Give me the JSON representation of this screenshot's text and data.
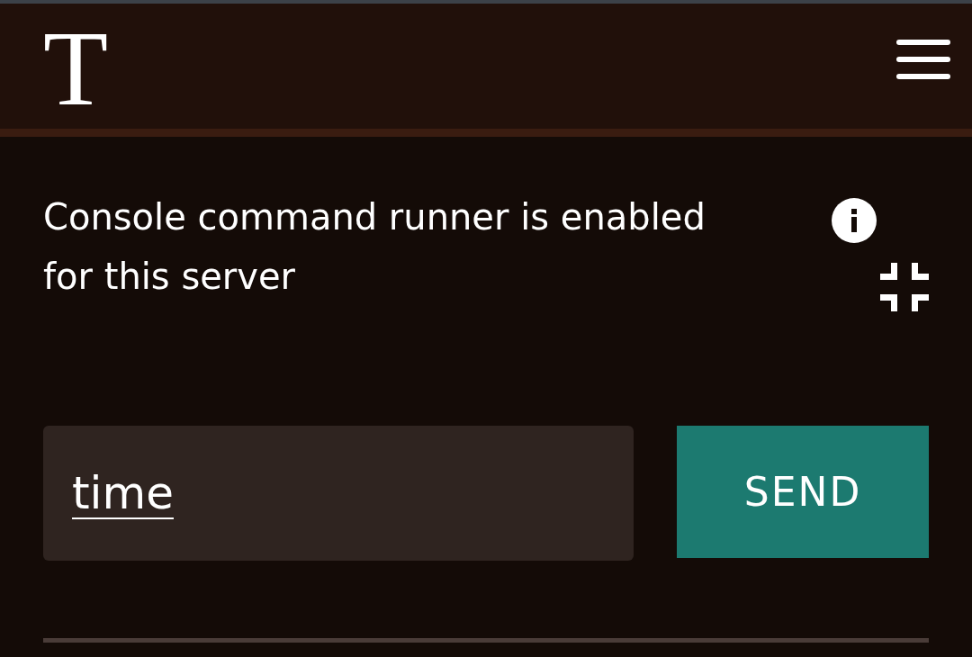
{
  "header": {
    "logo": "T"
  },
  "notice": {
    "text": "Console command runner is enabled for this server"
  },
  "command": {
    "value": "time",
    "button": "SEND"
  }
}
